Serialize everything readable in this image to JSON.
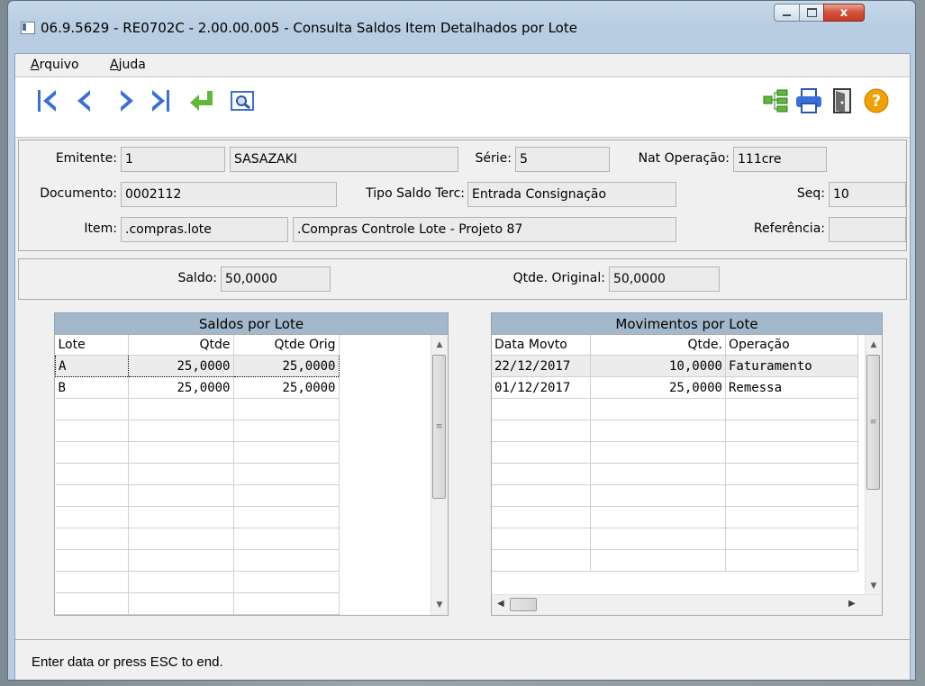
{
  "window": {
    "title": "06.9.5629 - RE0702C - 2.00.00.005 - Consulta Saldos Item Detalhados por Lote",
    "close_glyph": "x"
  },
  "menu": {
    "arquivo_first": "A",
    "arquivo_rest": "rquivo",
    "ajuda_first": "A",
    "ajuda_rest": "juda"
  },
  "toolbar": {
    "icons": [
      "first-record-icon",
      "previous-record-icon",
      "next-record-icon",
      "last-record-icon",
      "return-icon",
      "search-icon",
      "hierarchy-icon",
      "print-icon",
      "exit-door-icon",
      "help-icon"
    ],
    "help_glyph": "?"
  },
  "header": {
    "emitente_label": "Emitente:",
    "emitente_value": "1",
    "emitente_name": "SASAZAKI",
    "serie_label": "Série:",
    "serie_value": "5",
    "nat_label": "Nat Operação:",
    "nat_value": "111cre",
    "documento_label": "Documento:",
    "documento_value": "0002112",
    "tipo_label": "Tipo Saldo Terc:",
    "tipo_value": "Entrada Consignação",
    "seq_label": "Seq:",
    "seq_value": "10",
    "item_label": "Item:",
    "item_value": ".compras.lote",
    "item_desc": ".Compras Controle Lote - Projeto 87",
    "referencia_label": "Referência:",
    "referencia_value": ""
  },
  "saldo": {
    "saldo_label": "Saldo:",
    "saldo_value": "50,0000",
    "qtde_label": "Qtde. Original:",
    "qtde_value": "50,0000"
  },
  "saldos_grid": {
    "title": "Saldos por Lote",
    "columns": [
      "Lote",
      "Qtde",
      "Qtde Orig"
    ],
    "rows": [
      [
        "A",
        "25,0000",
        "25,0000"
      ],
      [
        "B",
        "25,0000",
        "25,0000"
      ]
    ]
  },
  "movimentos_grid": {
    "title": "Movimentos por Lote",
    "columns": [
      "Data Movto",
      "Qtde.",
      "Operação"
    ],
    "rows": [
      [
        "22/12/2017",
        "10,0000",
        "Faturamento"
      ],
      [
        "01/12/2017",
        "25,0000",
        "Remessa"
      ]
    ]
  },
  "status": {
    "text": "Enter data or press ESC to end."
  },
  "colors": {
    "accent": "#3a6fd8",
    "grid_title": "#a4b8cc",
    "return_arrow": "#5fb83a",
    "help": "#f0a000"
  }
}
